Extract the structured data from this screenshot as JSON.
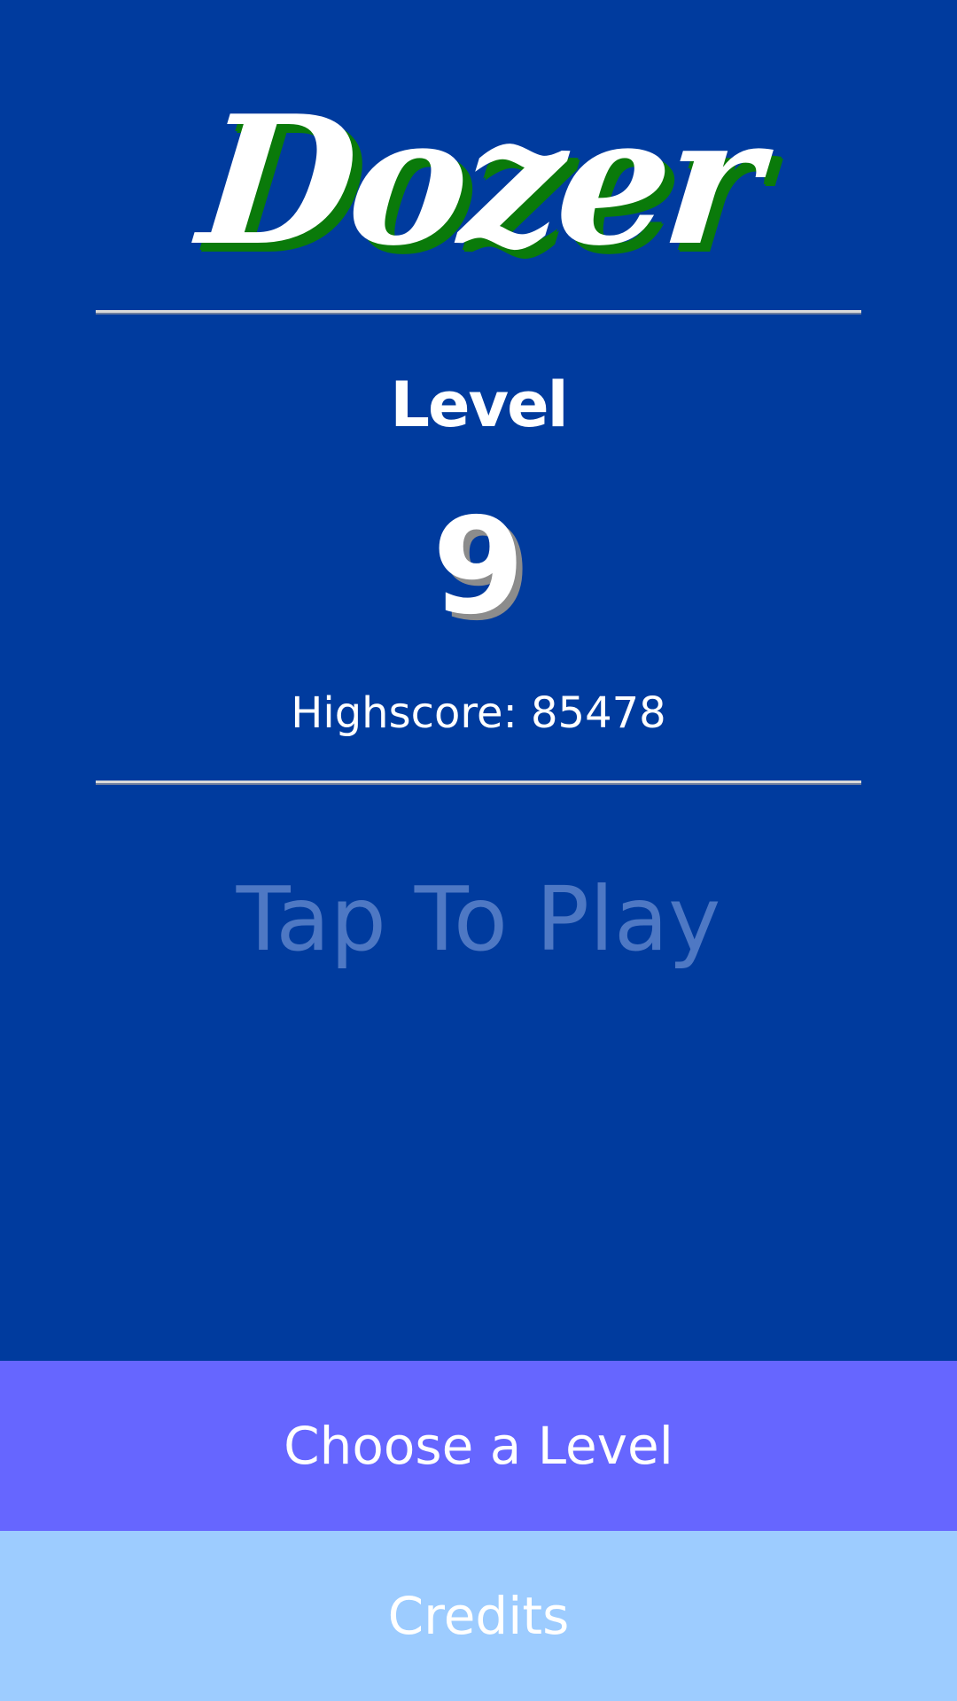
{
  "title": {
    "logo_text": "Dozer"
  },
  "level": {
    "label": "Level",
    "number": "9"
  },
  "highscore": {
    "text": "Highscore: 85478"
  },
  "prompt": {
    "tap_to_play": "Tap To Play"
  },
  "buttons": {
    "choose_level": "Choose a Level",
    "credits": "Credits"
  },
  "colors": {
    "background": "#003B9E",
    "logo_shadow": "#0A7A0A",
    "tap_to_play": "#4E78C4",
    "choose_level_button": "#6666FF",
    "credits_button": "#9DCCFF"
  }
}
